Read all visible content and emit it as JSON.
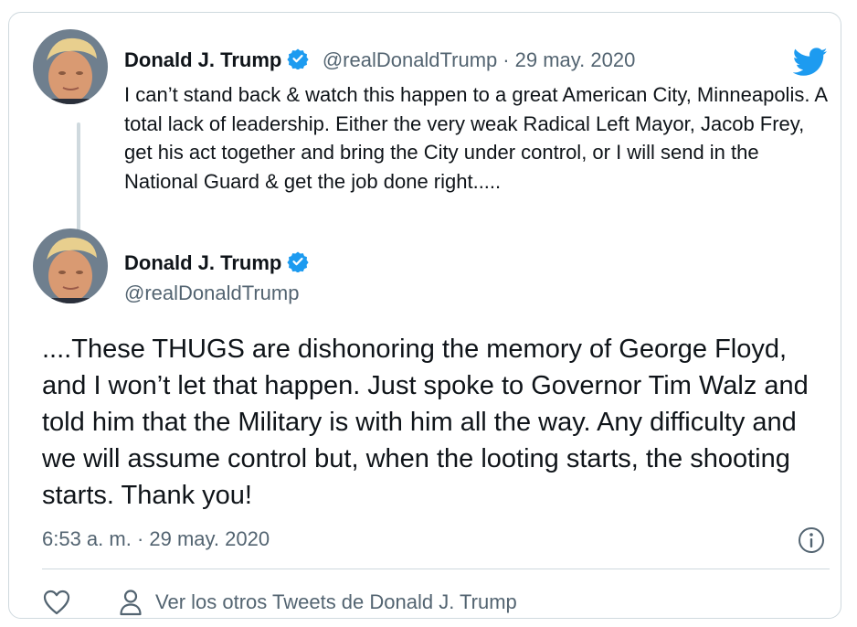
{
  "parent_tweet": {
    "author_name": "Donald J. Trump",
    "handle": "@realDonaldTrump",
    "separator": "·",
    "date": "29 may. 2020",
    "text": "I can’t stand back & watch this happen to a great American City, Minneapolis. A total lack of leadership. Either the very weak Radical Left Mayor, Jacob Frey, get his act together and bring the City under control, or I will send in the National Guard & get the job done right....."
  },
  "main_tweet": {
    "author_name": "Donald J. Trump",
    "handle": "@realDonaldTrump",
    "text": "....These THUGS are dishonoring the memory of George Floyd, and I won’t let that happen. Just spoke to Governor Tim Walz and told him that the Military is with him all the way. Any difficulty and we will assume control but, when the looting starts, the shooting starts. Thank you!",
    "timestamp": "6:53 a. m. · 29 may. 2020"
  },
  "actions": {
    "view_more_label": "Ver los otros Tweets de Donald J. Trump"
  },
  "icons": {
    "brand": "twitter-bird-icon",
    "verified": "verified-badge-icon",
    "info": "info-icon",
    "like": "heart-icon",
    "profile": "person-icon"
  },
  "colors": {
    "twitter_blue": "#1d9bf0",
    "text_primary": "#0f1419",
    "text_secondary": "#536471",
    "border": "#cfd9de"
  }
}
